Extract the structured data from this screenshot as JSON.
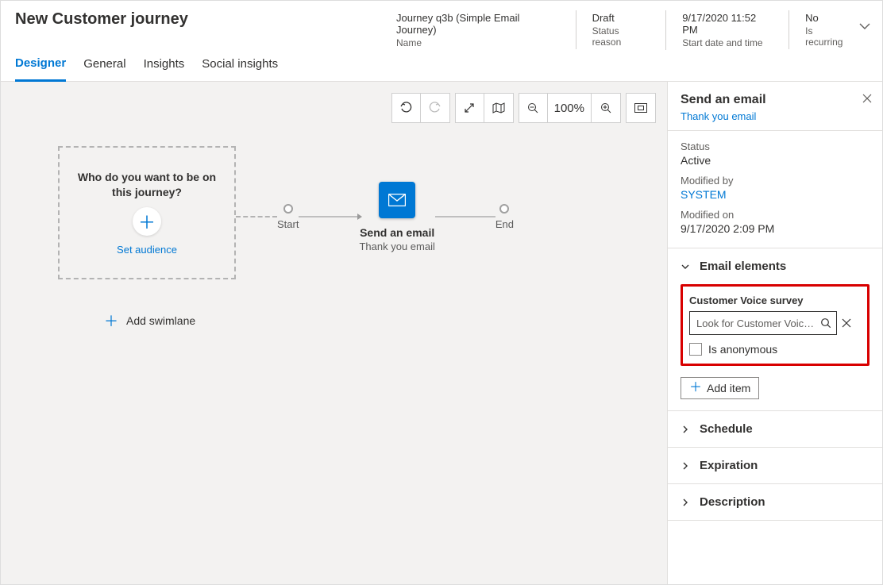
{
  "header": {
    "title": "New Customer journey",
    "meta": [
      {
        "value": "Journey q3b (Simple Email Journey)",
        "label": "Name"
      },
      {
        "value": "Draft",
        "label": "Status reason"
      },
      {
        "value": "9/17/2020 11:52 PM",
        "label": "Start date and time"
      },
      {
        "value": "No",
        "label": "Is recurring"
      }
    ]
  },
  "tabs": [
    "Designer",
    "General",
    "Insights",
    "Social insights"
  ],
  "toolbar": {
    "zoom": "100%"
  },
  "canvas": {
    "audience": {
      "question": "Who do you want to be on this journey?",
      "link": "Set audience"
    },
    "start_label": "Start",
    "end_label": "End",
    "email_node": {
      "title": "Send an email",
      "subtitle": "Thank you email"
    },
    "add_swimlane": "Add swimlane"
  },
  "pane": {
    "title": "Send an email",
    "link": "Thank you email",
    "props": {
      "status_label": "Status",
      "status_value": "Active",
      "modifiedby_label": "Modified by",
      "modifiedby_value": "SYSTEM",
      "modifiedon_label": "Modified on",
      "modifiedon_value": "9/17/2020 2:09 PM"
    },
    "elements": {
      "heading": "Email elements",
      "survey_label": "Customer Voice survey",
      "survey_placeholder": "Look for Customer Voice survey",
      "anon_label": "Is anonymous",
      "add_item": "Add item"
    },
    "schedule_heading": "Schedule",
    "expiration_heading": "Expiration",
    "description_heading": "Description"
  }
}
